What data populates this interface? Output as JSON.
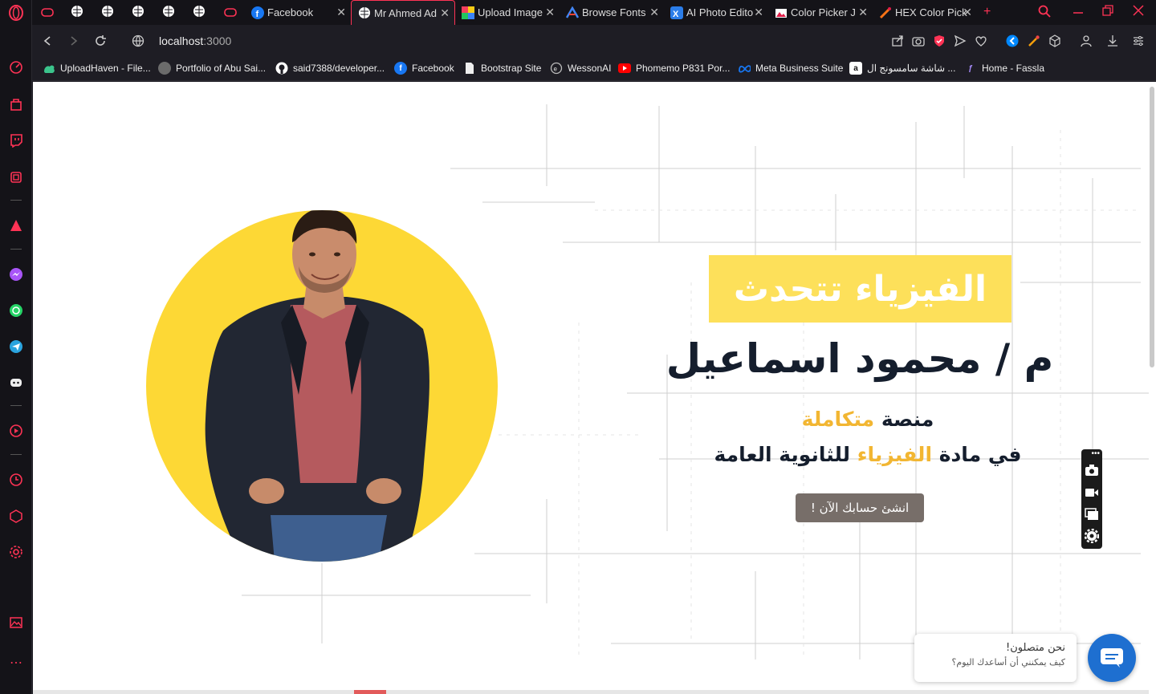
{
  "browser": {
    "tabs": [
      {
        "label": "Facebook",
        "icon": "facebook-icon"
      },
      {
        "label": "Mr Ahmed Ad",
        "icon": "globe-icon",
        "active": true
      },
      {
        "label": "Upload Image",
        "icon": "upload-image-icon"
      },
      {
        "label": "Browse Fonts",
        "icon": "fonts-icon"
      },
      {
        "label": "AI Photo Edito",
        "icon": "photo-editor-icon"
      },
      {
        "label": "Color Picker J",
        "icon": "color-picker-icon"
      },
      {
        "label": "HEX Color Pick",
        "icon": "hex-color-icon"
      }
    ],
    "address": {
      "host": "localhost",
      "port": ":3000"
    },
    "bookmarks": [
      {
        "label": "UploadHaven - File...",
        "icon": "uploadhaven-icon",
        "color": "#3bc48c"
      },
      {
        "label": "Portfolio of Abu Sai...",
        "icon": "avatar-icon",
        "color": "#6b6b6b"
      },
      {
        "label": "said7388/developer...",
        "icon": "github-icon",
        "color": "#333333"
      },
      {
        "label": "Facebook",
        "icon": "facebook-icon",
        "color": "#1877f2"
      },
      {
        "label": "Bootstrap Site",
        "icon": "file-icon",
        "color": "#eeeeee"
      },
      {
        "label": "WessonAI",
        "icon": "wesson-icon",
        "color": "#444444"
      },
      {
        "label": "Phomemo P831 Por...",
        "icon": "youtube-icon",
        "color": "#ff0000"
      },
      {
        "label": "Meta Business Suite",
        "icon": "meta-icon",
        "color": "#1877f2"
      },
      {
        "label": "شاشة سامسونج ال ...",
        "icon": "amazon-icon",
        "color": "#ffffff"
      },
      {
        "label": "Home - Fassla",
        "icon": "fassla-icon",
        "color": "#7c3aed"
      }
    ]
  },
  "hero": {
    "badge": "الفيزياء تتحدث",
    "teacher": "م / محمود اسماعيل",
    "line1_a": "منصة ",
    "line1_b": "متكاملة",
    "line2_a": "في مادة ",
    "line2_b": "الفيزياء",
    "line2_c": " للثانوية العامة",
    "cta": "انشئ حسابك الآن !"
  },
  "chat": {
    "title": "نحن متصلون!",
    "subtitle": "كيف يمكنني أن أساعدك اليوم؟"
  },
  "colors": {
    "accent": "#f2b632",
    "circle": "#fdd835",
    "browser_accent": "#ff3355",
    "chat": "#1e6fd0"
  }
}
